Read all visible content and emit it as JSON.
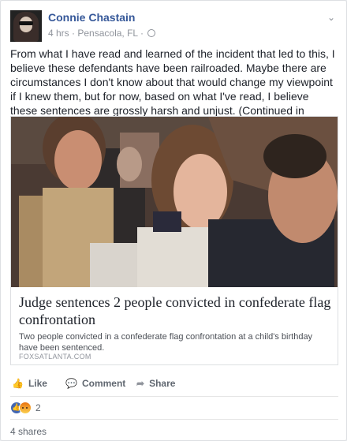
{
  "post": {
    "author": "Connie Chastain",
    "time": "4 hrs",
    "separator": "·",
    "location": "Pensacola, FL",
    "separator2": "·",
    "text": "From what I have read and learned of the incident that led to this, I believe these defendants have been railroaded. Maybe there are circumstances I don't know about that would change my viewpoint if I knew them, but for now, based on what I've read, I believe these sentences are grossly harsh and unjust. (Continued in comments)"
  },
  "link": {
    "title": "Judge sentences 2 people convicted in confederate flag confrontation",
    "description": "Two people convicted in a confederate flag confrontation at a child's birthday have been sentenced.",
    "domain": "FOXSATLANTA.COM"
  },
  "actions": {
    "like": "Like",
    "comment": "Comment",
    "share": "Share"
  },
  "reactions": {
    "count": "2",
    "types": [
      "like-icon",
      "angry-icon"
    ]
  },
  "shares": "4 shares",
  "colors": {
    "author_link": "#365899",
    "like_reaction": "#4267b2"
  }
}
